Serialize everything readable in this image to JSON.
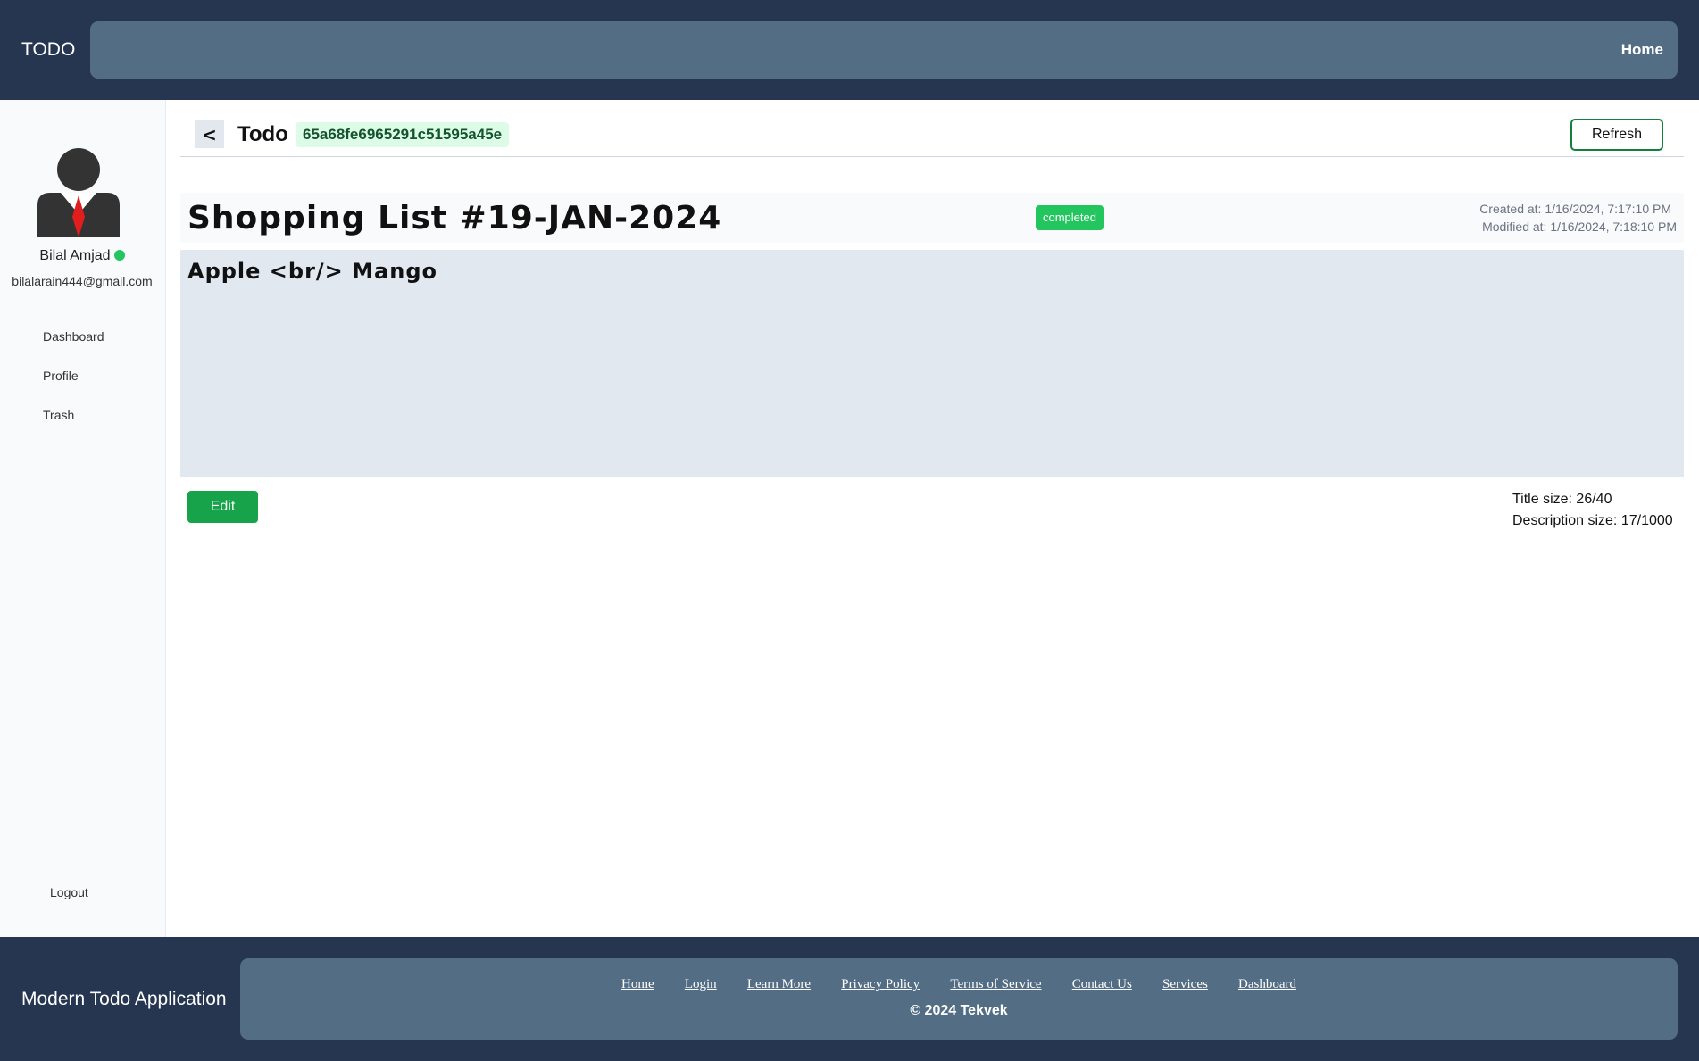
{
  "header": {
    "brand": "TODO",
    "nav_home": "Home"
  },
  "sidebar": {
    "user_name": "Bilal Amjad",
    "user_email": "bilalarain444@gmail.com",
    "status_color": "#22c55e",
    "items": [
      {
        "label": "Dashboard"
      },
      {
        "label": "Profile"
      },
      {
        "label": "Trash"
      }
    ],
    "logout": "Logout"
  },
  "main": {
    "back_label": "<",
    "page_title": "Todo",
    "todo_id": "65a68fe6965291c51595a45e",
    "refresh_label": "Refresh",
    "todo": {
      "title": "Shopping List #19-JAN-2024",
      "status": "completed",
      "created_at": "Created at: 1/16/2024, 7:17:10 PM",
      "modified_at": "Modified at: 1/16/2024, 7:18:10 PM",
      "description": "Apple <br/> Mango"
    },
    "edit_label": "Edit",
    "title_size": "Title size: 26/40",
    "description_size": "Description size: 17/1000"
  },
  "footer": {
    "brand": "Modern Todo Application",
    "links": [
      "Home",
      "Login",
      "Learn More",
      "Privacy Policy",
      "Terms of Service",
      "Contact Us",
      "Services",
      "Dashboard"
    ],
    "copyright": "© 2024 Tekvek"
  },
  "colors": {
    "header_bg": "#263650",
    "bar_bg": "#526d84",
    "accent_green": "#16a34a",
    "badge_green": "#22c55e"
  }
}
